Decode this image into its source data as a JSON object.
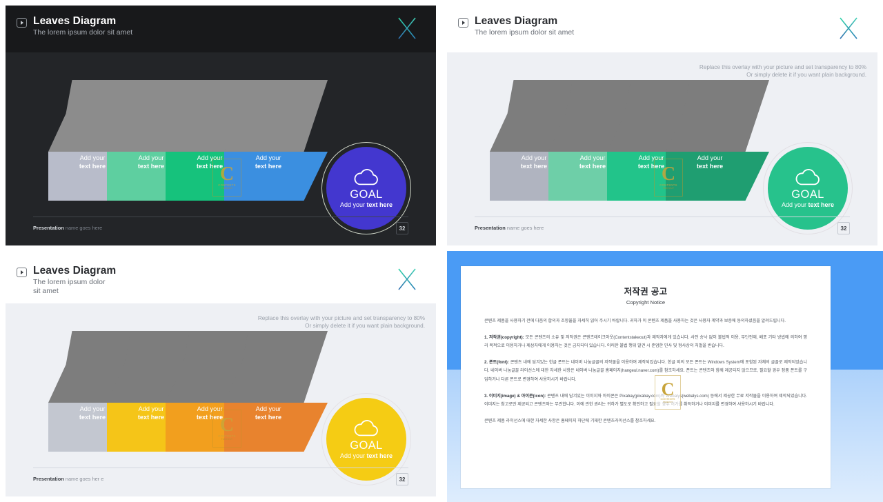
{
  "slides": [
    {
      "id": "slide-dark",
      "theme": "dark",
      "title": "Leaves Diagram",
      "subtitle": "The lorem ipsum dolor sit amet",
      "overlay_note_line1": "",
      "overlay_note_line2": "",
      "chevrons": [
        {
          "line1": "Add your",
          "line2": "text here",
          "top_color": "#8c8c8c",
          "bottom_color": "#b8bcca"
        },
        {
          "line1": "Add your",
          "line2": "text here",
          "top_color": "#8c8c8c",
          "bottom_color": "#5ecfa0"
        },
        {
          "line1": "Add your",
          "line2": "text here",
          "top_color": "#8c8c8c",
          "bottom_color": "#16c27c"
        },
        {
          "line1": "Add your",
          "line2": "text here",
          "top_color": "#8c8c8c",
          "bottom_color": "#3b8fe0"
        }
      ],
      "goal": {
        "label": "GOAL",
        "sub_normal": "Add your ",
        "sub_bold": "text here",
        "color": "#4337cf",
        "ring_color": "#cfd6c8"
      },
      "watermark": {
        "letter": "C",
        "line1": "CONTENTS",
        "line2": "TAKEOUT"
      },
      "footer": {
        "bold": "Presentation",
        "normal": " name goes here",
        "page": "32"
      }
    },
    {
      "id": "slide-green",
      "theme": "light",
      "title": "Leaves Diagram",
      "subtitle": "The lorem ipsum dolor sit amet",
      "overlay_note_line1": "Replace this overlay with your picture and set transparency to 80%",
      "overlay_note_line2": "Or simply delete it if you want plain background.",
      "chevrons": [
        {
          "line1": "Add your",
          "line2": "text here",
          "top_color": "#7d7d7d",
          "bottom_color": "#b0b4c0"
        },
        {
          "line1": "Add your",
          "line2": "text here",
          "top_color": "#7d7d7d",
          "bottom_color": "#6ecfa8"
        },
        {
          "line1": "Add your",
          "line2": "text here",
          "top_color": "#7d7d7d",
          "bottom_color": "#22c48a"
        },
        {
          "line1": "Add your",
          "line2": "text here",
          "top_color": "#7d7d7d",
          "bottom_color": "#1f9e71"
        }
      ],
      "goal": {
        "label": "GOAL",
        "sub_normal": "Add your ",
        "sub_bold": "text here",
        "color": "#27c28c",
        "ring_color": "#e2dfe4"
      },
      "watermark": {
        "letter": "C",
        "line1": "CONTENTS",
        "line2": "TAKEOUT"
      },
      "footer": {
        "bold": "Presentation",
        "normal": " name goes here",
        "page": "32"
      }
    },
    {
      "id": "slide-orange",
      "theme": "light",
      "title": "Leaves Diagram",
      "subtitle": "The lorem ipsum dolor sit amet",
      "overlay_note_line1": "Replace this overlay with your picture and set transparency to 80%",
      "overlay_note_line2": "Or simply delete it if you want plain background.",
      "chevrons": [
        {
          "line1": "Add your",
          "line2": "text here",
          "top_color": "#7d7d7d",
          "bottom_color": "#c3c7d0"
        },
        {
          "line1": "Add your",
          "line2": "text here",
          "top_color": "#7d7d7d",
          "bottom_color": "#f5c518"
        },
        {
          "line1": "Add your",
          "line2": "text here",
          "top_color": "#7d7d7d",
          "bottom_color": "#f29f1e"
        },
        {
          "line1": "Add your",
          "line2": "text here",
          "top_color": "#7d7d7d",
          "bottom_color": "#e8832e"
        }
      ],
      "goal": {
        "label": "GOAL",
        "sub_normal": "Add your ",
        "sub_bold": "text here",
        "color": "#f5cc14",
        "ring_color": "#e4e2e6"
      },
      "watermark": {
        "letter": "C",
        "line1": "CONTENTS",
        "line2": "TAKEOUT"
      },
      "footer": {
        "bold": "Presentation",
        "normal": " name goes her e",
        "page": "32"
      }
    }
  ],
  "copyright": {
    "frame_color": "#4a9bf5",
    "title": "저작권 공고",
    "subtitle": "Copyright Notice",
    "paragraphs": [
      {
        "lead": "",
        "text": "콘텐츠 제품을 사용하기 전에 다음의 합의과 조항율을 자세히 읽어 주시기 바랍니다. 귀하가 이 콘텐츠 제품을 사용하는 것은 사용자 계약과 보증에 동의하셨음을 알려드립니다."
      },
      {
        "lead": "1. 저작권(copyright): ",
        "text": "모든 콘텐츠의 소유 및 저작권은 콘텐츠테이크아웃(Contentstakeout)과 제작자에게 있습니다. 사전 승낙 없이 불법적 이용, 무단전재, 배포 기타 방법에 의하여 영리 목적으로 이용하거나 제삼자에게 이용하는 것은 금지되어 있습니다. 이러한 불법 행위 발견 시 준엄한 민사 및 형사상의 처벌을 받습니다."
      },
      {
        "lead": "2. 폰트(font): ",
        "text": "콘텐츠 내에 담겨있는 한글 폰트는 네이버 나눔글꼴의 저작물을 이용하여 제작되었습니다. 한글 외의 모든 폰트는 Windows System에 포함된 자체의 글꼴로 제작되었습니다. 네이버 나눔글꼴 라이선스에 대한 자세한 사항은 네이버 나눔글꼴 홈페이지(hangeul.naver.com)를 참조하세요. 폰트는 콘텐츠와 함께 제공되지 않으므로, 필요할 경우 정품 폰트를 구입하거나 다른 폰트로 변경하여 사용하시기 바랍니다."
      },
      {
        "lead": "3. 이미지(image) & 아이콘(icon): ",
        "text": "콘텐츠 내에 담겨있는 이미지와 아이콘은 Pixabay(pixabay.com)와 Webalys(webalys.com) 등에서 제공한 무료 저작물을 이용하여 제작되었습니다. 이미지는 참고로만 제공되고 콘텐츠와는 무관합니다. 이에 관한 권리는 귀하가 별도로 확인하고 필요할 경우 허가를 취득하거나 이미지를 변경하여 사용하시기 바랍니다."
      },
      {
        "lead": "",
        "text": "콘텐츠 제품 라이선스에 대한 자세한 사항은 홈페이지 하단에 기재한 콘텐츠라이선스를 참조하세요."
      }
    ],
    "watermark": {
      "letter": "C",
      "line1": "CONTENTS",
      "line2": "TAKEOUT"
    }
  }
}
